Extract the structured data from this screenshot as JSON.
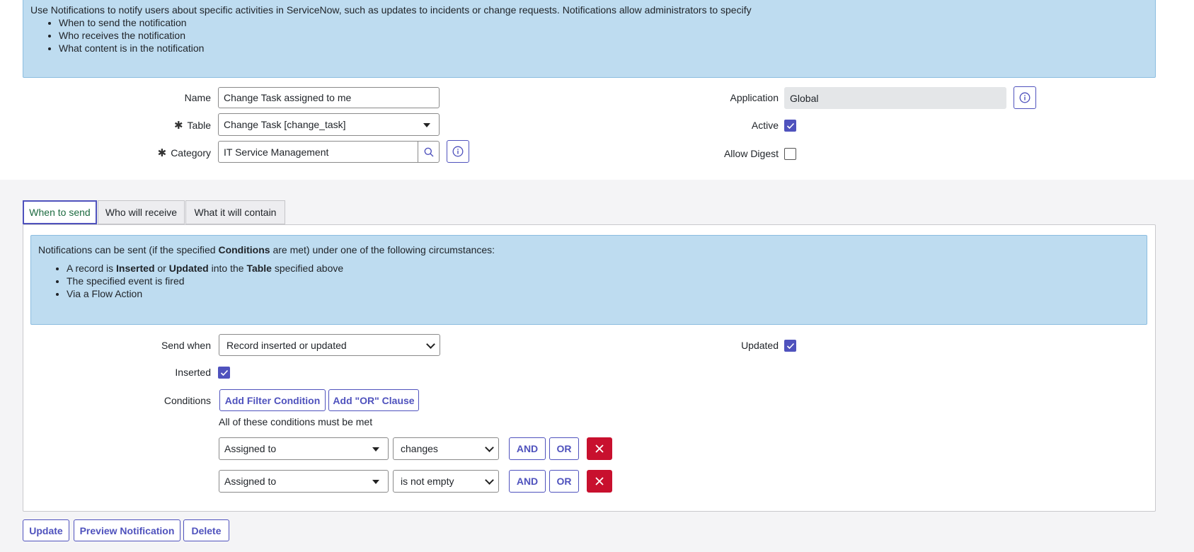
{
  "intro": {
    "text": "Use Notifications to notify users about specific activities in ServiceNow, such as updates to incidents or change requests. Notifications allow administrators to specify",
    "bullets": [
      "When to send the notification",
      "Who receives the notification",
      "What content is in the notification"
    ]
  },
  "form": {
    "name_label": "Name",
    "name_value": "Change Task assigned to me",
    "table_label": "Table",
    "table_value": "Change Task [change_task]",
    "category_label": "Category",
    "category_value": "IT Service Management",
    "application_label": "Application",
    "application_value": "Global",
    "active_label": "Active",
    "active_checked": true,
    "allow_digest_label": "Allow Digest",
    "allow_digest_checked": false,
    "required_mark": "✱"
  },
  "tabs": [
    {
      "label": "When to send",
      "active": true
    },
    {
      "label": "Who will receive",
      "active": false
    },
    {
      "label": "What it will contain",
      "active": false
    }
  ],
  "when_info": {
    "intro_pre": "Notifications can be sent (if the specified ",
    "intro_bold": "Conditions",
    "intro_post": " are met) under one of the following circumstances:",
    "b1_pre": "A record is ",
    "b1_bold1": "Inserted",
    "b1_mid": " or ",
    "b1_bold2": "Updated",
    "b1_mid2": " into the ",
    "b1_bold3": "Table",
    "b1_post": " specified above",
    "b2": "The specified event is fired",
    "b3": "Via a Flow Action"
  },
  "send": {
    "send_when_label": "Send when",
    "send_when_value": "Record inserted or updated",
    "updated_label": "Updated",
    "updated_checked": true,
    "inserted_label": "Inserted",
    "inserted_checked": true,
    "conditions_label": "Conditions",
    "add_filter_label": "Add Filter Condition",
    "add_or_label": "Add \"OR\" Clause",
    "all_met_text": "All of these conditions must be met",
    "rows": [
      {
        "field": "Assigned to",
        "operator": "changes",
        "and": "AND",
        "or": "OR"
      },
      {
        "field": "Assigned to",
        "operator": "is not empty",
        "and": "AND",
        "or": "OR"
      }
    ]
  },
  "footer": {
    "update_label": "Update",
    "preview_label": "Preview Notification",
    "delete_label": "Delete"
  },
  "colors": {
    "accent": "#4f52bd",
    "info_bg": "#bedcf0",
    "delete_red": "#c8102e"
  }
}
